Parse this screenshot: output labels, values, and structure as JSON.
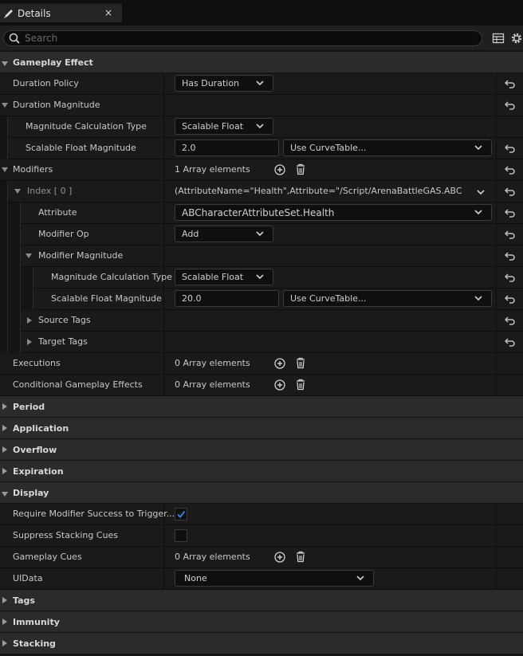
{
  "tab": {
    "title": "Details",
    "close": "×"
  },
  "search": {
    "placeholder": "Search"
  },
  "rows": {
    "gameplay_effect": "Gameplay Effect",
    "duration_policy": {
      "label": "Duration Policy",
      "value": "Has Duration"
    },
    "duration_magnitude": "Duration Magnitude",
    "dm_calc_type": {
      "label": "Magnitude Calculation Type",
      "value": "Scalable Float"
    },
    "dm_scalable": {
      "label": "Scalable Float Magnitude",
      "value": "2.0",
      "curve": "Use CurveTable..."
    },
    "modifiers": {
      "label": "Modifiers",
      "value": "1 Array elements"
    },
    "index0": {
      "label": "Index [ 0 ]",
      "value": "(AttributeName=\"Health\",Attribute=\"/Script/ArenaBattleGAS.ABCharacte"
    },
    "attribute": {
      "label": "Attribute",
      "value": "ABCharacterAttributeSet.Health"
    },
    "modifier_op": {
      "label": "Modifier Op",
      "value": "Add"
    },
    "modifier_magnitude": "Modifier Magnitude",
    "mm_calc_type": {
      "label": "Magnitude Calculation Type",
      "value": "Scalable Float"
    },
    "mm_scalable": {
      "label": "Scalable Float Magnitude",
      "value": "20.0",
      "curve": "Use CurveTable..."
    },
    "source_tags": "Source Tags",
    "target_tags": "Target Tags",
    "executions": {
      "label": "Executions",
      "value": "0 Array elements"
    },
    "conditional": {
      "label": "Conditional Gameplay Effects",
      "value": "0 Array elements"
    },
    "period": "Period",
    "application": "Application",
    "overflow": "Overflow",
    "expiration": "Expiration",
    "display": "Display",
    "require_modifier": {
      "label": "Require Modifier Success to Trigger...",
      "checked": true
    },
    "suppress_stacking": {
      "label": "Suppress Stacking Cues",
      "checked": false
    },
    "gameplay_cues": {
      "label": "Gameplay Cues",
      "value": "0 Array elements"
    },
    "uidata": {
      "label": "UIData",
      "value": "None"
    },
    "tags": "Tags",
    "immunity": "Immunity",
    "stacking": "Stacking"
  },
  "colors": {
    "accent": "#2f7fd8",
    "category_bg": "#2b2b2b",
    "row_bg": "#1a1a1a"
  }
}
